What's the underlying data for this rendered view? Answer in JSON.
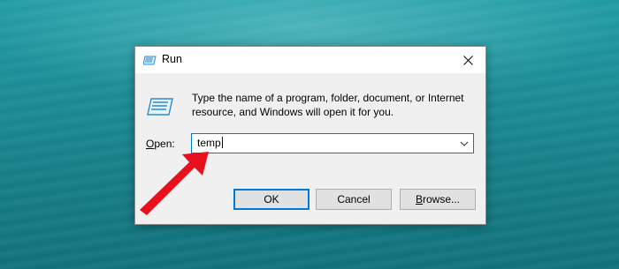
{
  "window": {
    "title": "Run"
  },
  "description": {
    "line1": "Type the name of a program, folder, document, or Internet",
    "line2": "resource, and Windows will open it for you."
  },
  "open_field": {
    "label_underlined": "O",
    "label_rest": "pen:",
    "value": "temp"
  },
  "buttons": {
    "ok": "OK",
    "cancel": "Cancel",
    "browse_underlined": "B",
    "browse_rest": "rowse..."
  },
  "icons": {
    "title": "run-icon",
    "close": "close-icon",
    "dropdown": "chevron-down-icon",
    "annotation": "red-arrow-icon"
  },
  "colors": {
    "accent": "#0078d7",
    "annotation": "#e8101c"
  }
}
